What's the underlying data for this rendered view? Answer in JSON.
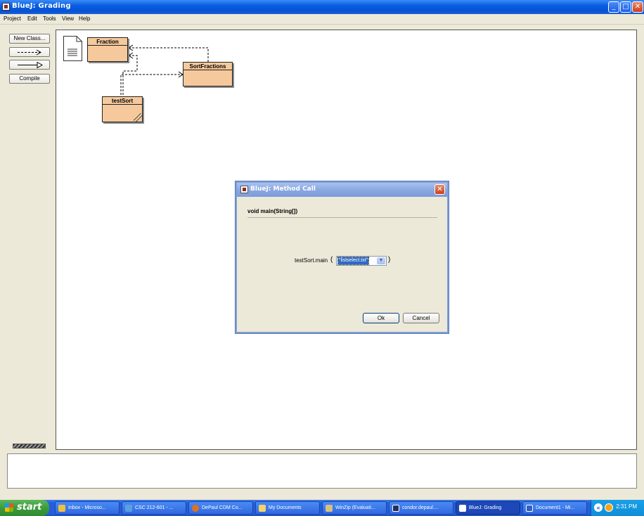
{
  "window": {
    "title": "BlueJ:  Grading",
    "minimize": "_",
    "maximize": "□",
    "close": "✕"
  },
  "menu": {
    "items": [
      "Project",
      "Edit",
      "Tools",
      "View",
      "Help"
    ]
  },
  "tools": {
    "new_class": "New Class...",
    "dependency_arrow": "dependency-arrow",
    "inheritance_arrow": "inheritance-arrow",
    "compile": "Compile"
  },
  "diagram": {
    "readme": "README",
    "classes": [
      {
        "name": "Fraction",
        "compiled": true
      },
      {
        "name": "SortFractions",
        "compiled": true
      },
      {
        "name": "testSort",
        "compiled": false
      }
    ]
  },
  "dialog": {
    "title": "BlueJ:  Method Call",
    "signature": "void main(String[])",
    "call_label": "testSort.main",
    "open_paren": "(",
    "close_paren": ")",
    "argument_value": "\"listselect.txt\"",
    "ok_label": "Ok",
    "cancel_label": "Cancel",
    "close": "✕"
  },
  "taskbar": {
    "start_label": "start",
    "tasks": [
      {
        "label": "Inbox - Microso...",
        "icon": "outlook-icon",
        "color": "#f0c040"
      },
      {
        "label": "CSC 212-601 - ...",
        "icon": "ie-icon",
        "color": "#5aa0e0"
      },
      {
        "label": "DePaul CDM Co...",
        "icon": "firefox-icon",
        "color": "#e07020"
      },
      {
        "label": "My Documents",
        "icon": "folder-icon",
        "color": "#f5d36b"
      },
      {
        "label": "WinZip (Evaluati...",
        "icon": "winzip-icon",
        "color": "#d8c080"
      },
      {
        "label": "condor.depaul....",
        "icon": "terminal-icon",
        "color": "#203060"
      },
      {
        "label": "BlueJ:  Grading",
        "icon": "bluej-icon",
        "color": "#ffffff",
        "active": true
      },
      {
        "label": "Document1 - Mi...",
        "icon": "word-icon",
        "color": "#3060c0"
      }
    ],
    "clock": "2:31 PM",
    "tray_expand": "«"
  }
}
